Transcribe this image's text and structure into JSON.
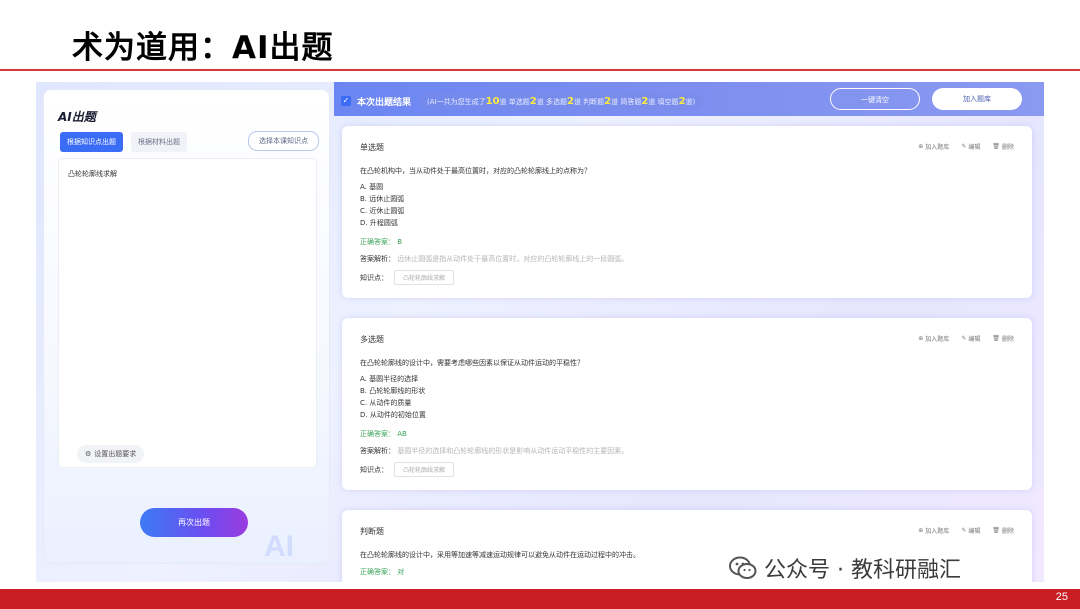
{
  "slide": {
    "title": "术为道用：AI出题",
    "page_number": "25",
    "watermark": "公众号 · 教科研融汇"
  },
  "left_panel": {
    "title": "AI出题",
    "tabs": [
      {
        "label": "根据知识点出题",
        "active": true
      },
      {
        "label": "根据材料出题",
        "active": false
      }
    ],
    "choose_button": "选择本课知识点",
    "textarea_value": "凸轮轮廓线求解",
    "settings_button": "设置出题要求",
    "regenerate_button": "再次出题",
    "deco_text": "AI"
  },
  "results": {
    "title": "本次出题结果",
    "summary_parts": [
      {
        "text": "(AI一共为您生成了",
        "num": "10",
        "unit": "道"
      },
      {
        "text": " 单选题",
        "num": "2",
        "unit": "道"
      },
      {
        "text": " 多选题",
        "num": "2",
        "unit": "道"
      },
      {
        "text": " 判断题",
        "num": "2",
        "unit": "道"
      },
      {
        "text": " 简答题",
        "num": "2",
        "unit": "道"
      },
      {
        "text": " 填空题",
        "num": "2",
        "unit": "道)"
      }
    ],
    "clear_button": "一键清空",
    "add_bank_button": "加入题库"
  },
  "actions": {
    "add": "加入题库",
    "edit": "编辑",
    "delete": "删除"
  },
  "questions": [
    {
      "type": "单选题",
      "stem": "在凸轮机构中，当从动件处于最高位置时，对应的凸轮轮廓线上的点称为？",
      "options": [
        "A. 基圆",
        "B. 远休止圆弧",
        "C. 近休止圆弧",
        "D. 升程圆弧"
      ],
      "answer_label": "正确答案：",
      "answer": "B",
      "analysis_label": "答案解析：",
      "analysis": "远休止圆弧是指从动件处于最高位置时，对应的凸轮轮廓线上的一段圆弧。",
      "kp_label": "知识点：",
      "kp": "凸轮轮廓线求解"
    },
    {
      "type": "多选题",
      "stem": "在凸轮轮廓线的设计中，需要考虑哪些因素以保证从动件运动的平稳性？",
      "options": [
        "A. 基圆半径的选择",
        "B. 凸轮轮廓线的形状",
        "C. 从动件的质量",
        "D. 从动件的初始位置"
      ],
      "answer_label": "正确答案：",
      "answer": "AB",
      "analysis_label": "答案解析：",
      "analysis": "基圆半径的选择和凸轮轮廓线的形状是影响从动件运动平稳性的主要因素。",
      "kp_label": "知识点：",
      "kp": "凸轮轮廓线求解"
    },
    {
      "type": "判断题",
      "stem": "在凸轮轮廓线的设计中，采用等加速等减速运动规律可以避免从动件在运动过程中的冲击。",
      "answer_label": "正确答案：",
      "answer": "对"
    }
  ]
}
